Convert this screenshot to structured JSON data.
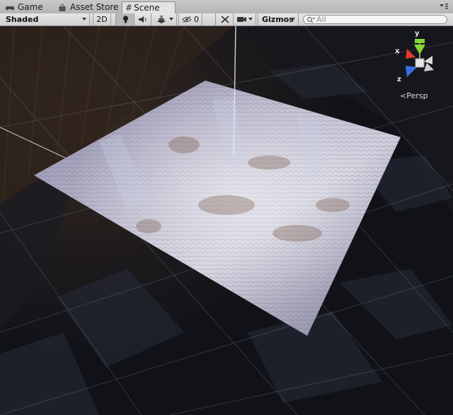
{
  "tabs": [
    {
      "label": "Game",
      "icon": "game-controller-icon"
    },
    {
      "label": "Asset Store",
      "icon": "store-bag-icon"
    },
    {
      "label": "Scene",
      "icon": "grid-hash-icon",
      "active": true
    }
  ],
  "toolbar": {
    "draw_mode": "Shaded",
    "mode_2d": "2D",
    "hidden_count": "0",
    "gizmos": "Gizmos",
    "search_placeholder": "All"
  },
  "gizmo": {
    "x": "x",
    "y": "y",
    "z": "z",
    "projection": "Persp"
  },
  "colors": {
    "x_axis": "#e03a2a",
    "y_axis": "#86d631",
    "z_axis": "#3a6fe0",
    "active_tab": "#e2e2e2"
  }
}
